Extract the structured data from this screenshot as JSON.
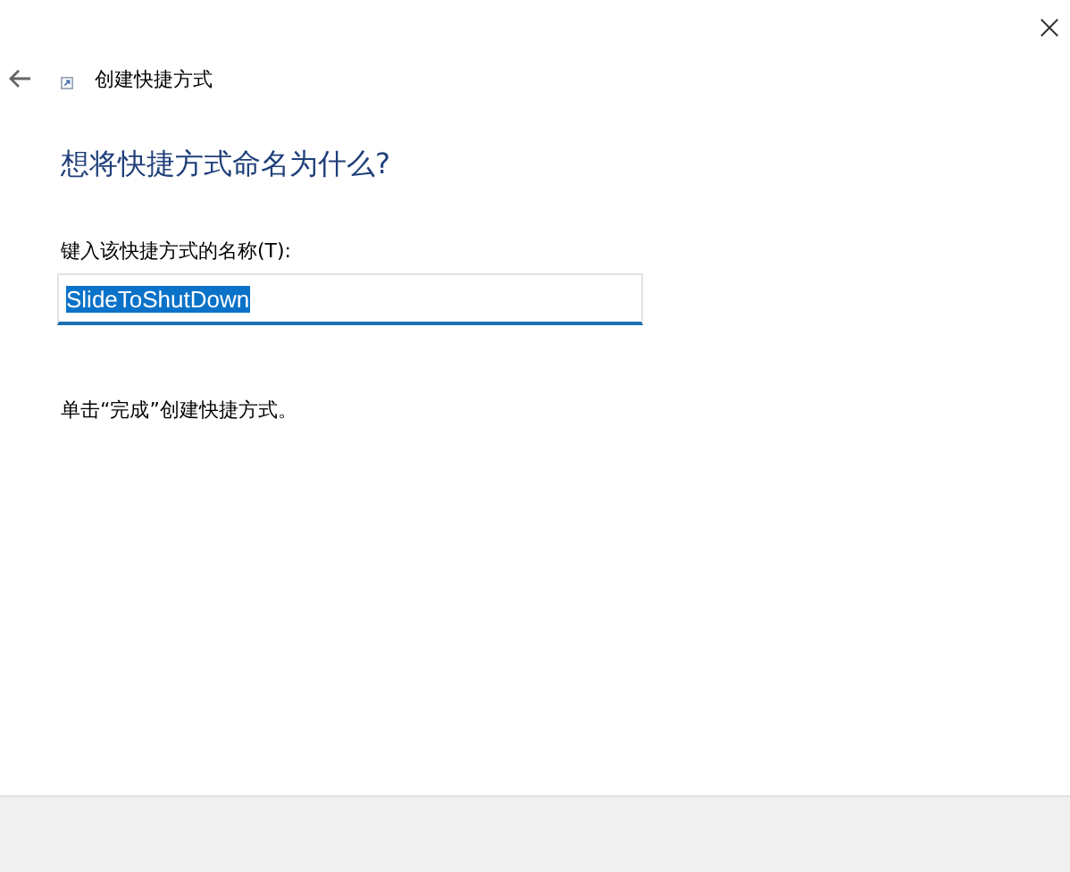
{
  "window": {
    "title": "创建快捷方式"
  },
  "heading": "想将快捷方式命名为什么?",
  "name_field": {
    "label": "键入该快捷方式的名称(T):",
    "value": "SlideToShutDown",
    "text_selected": true
  },
  "instruction": "单击“完成”创建快捷方式。"
}
